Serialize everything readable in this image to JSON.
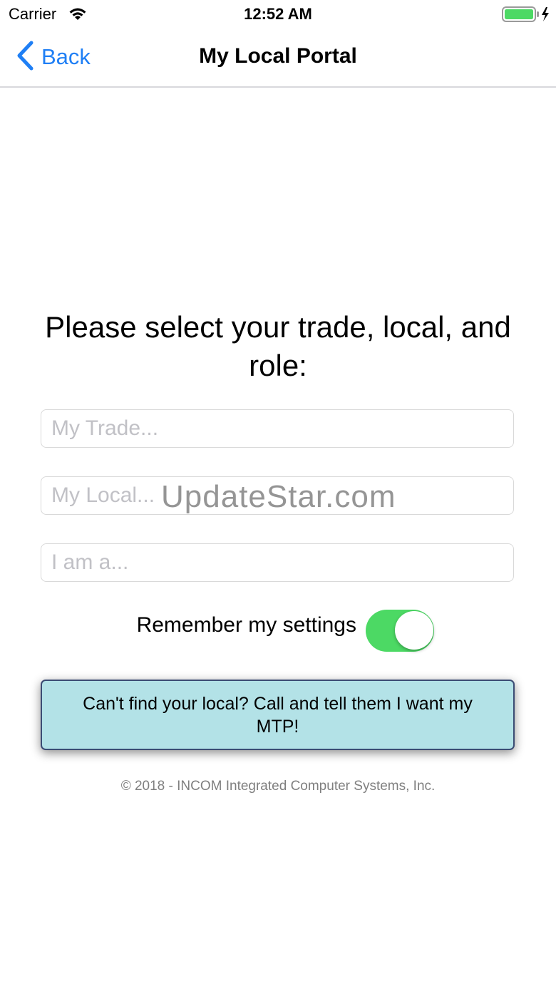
{
  "status_bar": {
    "carrier": "Carrier",
    "time": "12:52 AM",
    "battery_color": "#4cd964"
  },
  "nav": {
    "back_label": "Back",
    "title": "My Local Portal",
    "accent_color": "#1f7ff5"
  },
  "form": {
    "prompt": "Please select your trade, local, and role:",
    "trade_placeholder": "My Trade...",
    "local_placeholder": "My Local...",
    "role_placeholder": "I am a...",
    "remember_label": "Remember my settings",
    "remember_on": true,
    "toggle_color": "#4cd964"
  },
  "watermark": "UpdateStar.com",
  "cta": {
    "label": "Can't find your local? Call and tell them I want my MTP!",
    "background": "#b3e2e7"
  },
  "footer": {
    "copyright": "© 2018 - INCOM Integrated Computer Systems, Inc."
  },
  "icons": [
    "wifi-icon",
    "battery-icon",
    "charging-bolt-icon",
    "back-chevron-icon"
  ]
}
